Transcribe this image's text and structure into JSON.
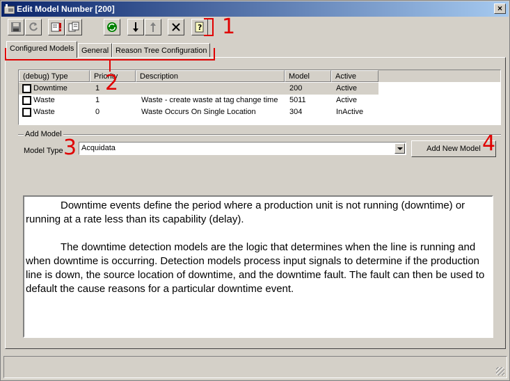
{
  "window": {
    "title": "Edit Model Number [200]",
    "close_glyph": "×"
  },
  "toolbar": {
    "buttons": [
      {
        "name": "save-icon"
      },
      {
        "name": "refresh-icon"
      },
      {
        "name": "alarm-icon"
      },
      {
        "name": "copy-icon"
      },
      {
        "name": "reload-icon"
      },
      {
        "name": "arrow-down-icon"
      },
      {
        "name": "arrow-up-icon"
      },
      {
        "name": "delete-icon"
      },
      {
        "name": "help-icon"
      }
    ]
  },
  "tabs": [
    {
      "label": "Configured Models",
      "active": true
    },
    {
      "label": "General",
      "active": false
    },
    {
      "label": "Reason Tree Configuration",
      "active": false
    }
  ],
  "list": {
    "columns": [
      "(debug) Type",
      "Priority",
      "Description",
      "Model",
      "Active"
    ],
    "rows": [
      {
        "type": "Downtime",
        "priority": "1",
        "description": "",
        "model": "200",
        "active": "Active",
        "selected": true
      },
      {
        "type": "Waste",
        "priority": "1",
        "description": "Waste - create waste at tag change time",
        "model": "5011",
        "active": "Active",
        "selected": false
      },
      {
        "type": "Waste",
        "priority": "0",
        "description": "Waste Occurs On Single Location",
        "model": "304",
        "active": "InActive",
        "selected": false
      }
    ]
  },
  "add_model": {
    "group_label": "Add Model",
    "model_type_label": "Model Type",
    "model_type_value": "Acquidata",
    "add_button_label": "Add New Model"
  },
  "description": {
    "paragraphs": [
      "Downtime events define the period where a production unit is not running (downtime) or running at a rate less than its capability (delay).",
      "The downtime detection models are the logic that determines when the line is running and when downtime is occurring.  Detection models process input signals to determine if the production line is down, the source location of downtime, and the downtime fault. The fault can then be used to default the cause reasons for a particular downtime event."
    ]
  },
  "annotations": [
    "1",
    "2",
    "3",
    "4"
  ],
  "colors": {
    "annotation": "#e00000",
    "title_start": "#0a246a",
    "title_end": "#a6caf0",
    "face": "#d4d0c8"
  }
}
